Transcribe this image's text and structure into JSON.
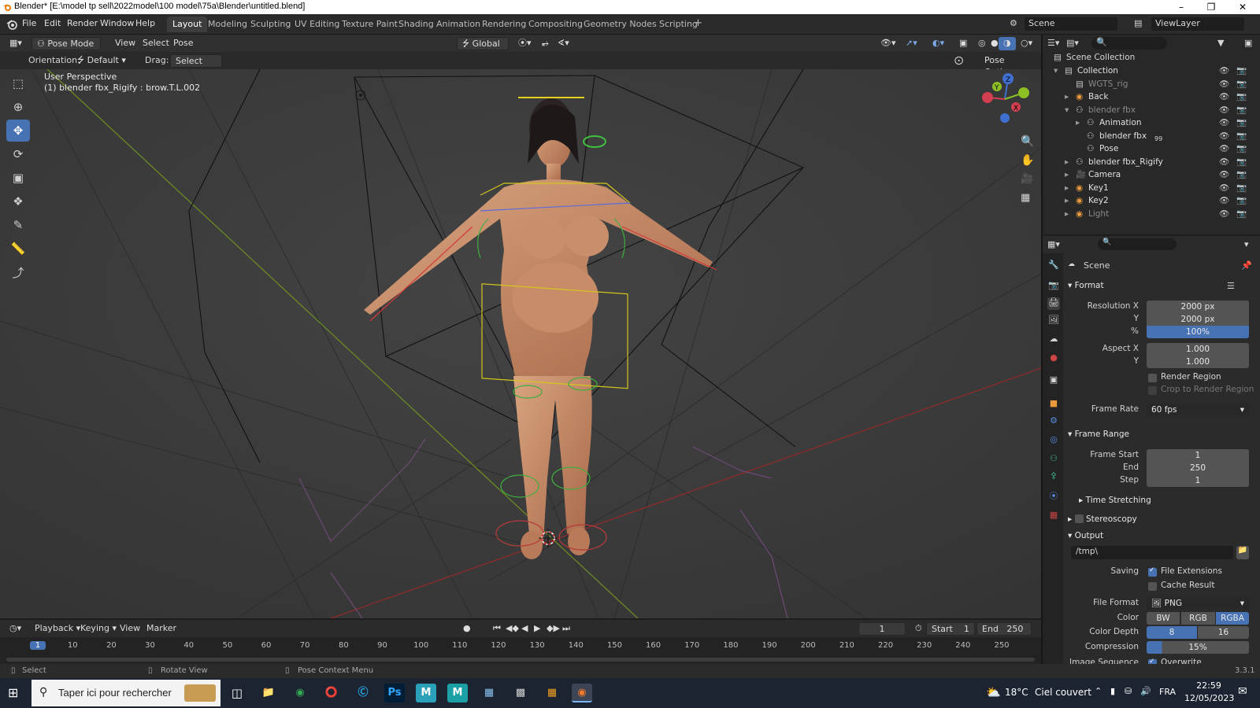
{
  "window": {
    "title": "Blender* [E:\\model tp sell\\2022model\\100 model\\75a\\Blender\\untitled.blend]"
  },
  "menu": [
    "File",
    "Edit",
    "Render",
    "Window",
    "Help"
  ],
  "workspaces": [
    "Layout",
    "Modeling",
    "Sculpting",
    "UV Editing",
    "Texture Paint",
    "Shading",
    "Animation",
    "Rendering",
    "Compositing",
    "Geometry Nodes",
    "Scripting"
  ],
  "active_workspace": "Layout",
  "scene_selector": "Scene",
  "viewlayer_selector": "ViewLayer",
  "header": {
    "mode": "Pose Mode",
    "menus": [
      "View",
      "Select",
      "Pose"
    ],
    "transform_orientation": "Global",
    "orientation_label": "Orientation:",
    "orientation_value": "Default",
    "drag_label": "Drag:",
    "drag_value": "Select Box",
    "pose_options": "Pose Options"
  },
  "viewport": {
    "view_name": "User Perspective",
    "active_info": "(1) blender fbx_Rigify : brow.T.L.002"
  },
  "outliner": {
    "scene_collection": "Scene Collection",
    "items": [
      {
        "name": "Collection",
        "indent": 1
      },
      {
        "name": "WGTS_rig",
        "indent": 2
      },
      {
        "name": "Back",
        "indent": 2
      },
      {
        "name": "blender fbx",
        "indent": 2
      },
      {
        "name": "Animation",
        "indent": 3
      },
      {
        "name": "blender fbx",
        "indent": 3,
        "badge": "99"
      },
      {
        "name": "Pose",
        "indent": 3
      },
      {
        "name": "blender fbx_Rigify",
        "indent": 2
      },
      {
        "name": "Camera",
        "indent": 2
      },
      {
        "name": "Key1",
        "indent": 2
      },
      {
        "name": "Key2",
        "indent": 2
      },
      {
        "name": "Light",
        "indent": 2
      }
    ]
  },
  "properties": {
    "context": "Scene",
    "format": {
      "title": "Format",
      "resolution_x_label": "Resolution X",
      "resolution_x": "2000 px",
      "resolution_y_label": "Y",
      "resolution_y": "2000 px",
      "percent_label": "%",
      "percent": "100%",
      "aspect_x_label": "Aspect X",
      "aspect_x": "1.000",
      "aspect_y_label": "Y",
      "aspect_y": "1.000",
      "render_region": "Render Region",
      "crop_region": "Crop to Render Region",
      "frame_rate_label": "Frame Rate",
      "frame_rate": "60 fps"
    },
    "frame_range": {
      "title": "Frame Range",
      "start_label": "Frame Start",
      "start": "1",
      "end_label": "End",
      "end": "250",
      "step_label": "Step",
      "step": "1",
      "time_stretching": "Time Stretching"
    },
    "stereoscopy": "Stereoscopy",
    "output": {
      "title": "Output",
      "path": "/tmp\\",
      "saving_label": "Saving",
      "file_extensions": "File Extensions",
      "cache_result": "Cache Result",
      "file_format_label": "File Format",
      "file_format": "PNG",
      "color_label": "Color",
      "color_options": [
        "BW",
        "RGB",
        "RGBA"
      ],
      "color_active": "RGBA",
      "color_depth_label": "Color Depth",
      "depth_options": [
        "8",
        "16"
      ],
      "compression_label": "Compression",
      "compression": "15%",
      "image_sequence_label": "Image Sequence",
      "overwrite": "Overwrite"
    }
  },
  "timeline": {
    "menus": [
      "Playback",
      "Keying",
      "View",
      "Marker"
    ],
    "current_frame": "1",
    "start_label": "Start",
    "start": "1",
    "end_label": "End",
    "end": "250",
    "ticks": [
      "1",
      "10",
      "20",
      "30",
      "40",
      "50",
      "60",
      "70",
      "80",
      "90",
      "100",
      "110",
      "120",
      "130",
      "140",
      "150",
      "160",
      "170",
      "180",
      "190",
      "200",
      "210",
      "220",
      "230",
      "240",
      "250"
    ]
  },
  "statusbar": {
    "select": "Select",
    "rotate": "Rotate View",
    "context": "Pose Context Menu",
    "version": "3.3.1"
  },
  "taskbar": {
    "search_placeholder": "Taper ici pour rechercher",
    "weather_temp": "18°C",
    "weather_desc": "Ciel couvert",
    "lang": "FRA",
    "time": "22:59",
    "date": "12/05/2023",
    "apps": [
      "Ps",
      "M",
      "M"
    ]
  },
  "colors": {
    "accent": "#4772b3",
    "viewport_bg": "#3a3a3a",
    "panel_bg": "#2b2b2b"
  }
}
